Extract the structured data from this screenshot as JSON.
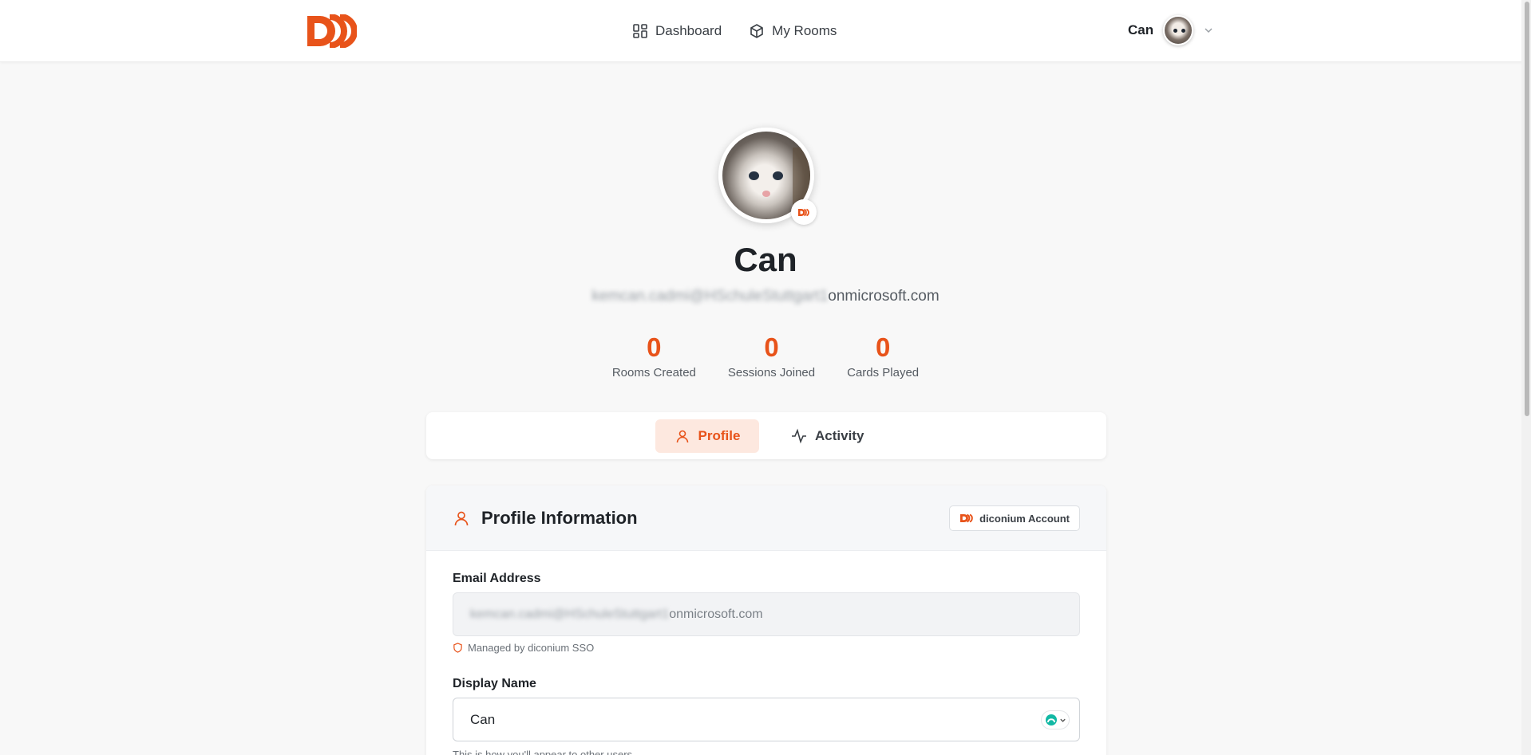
{
  "nav": {
    "links": [
      {
        "label": "Dashboard",
        "icon": "dashboard-icon"
      },
      {
        "label": "My Rooms",
        "icon": "cube-icon"
      }
    ],
    "user_name": "Can"
  },
  "profile": {
    "name": "Can",
    "email_hidden": "kemcan.cadmi@HSchuleStuttgart1",
    "email_visible": "onmicrosoft.com",
    "stats": [
      {
        "value": "0",
        "label": "Rooms Created"
      },
      {
        "value": "0",
        "label": "Sessions Joined"
      },
      {
        "value": "0",
        "label": "Cards Played"
      }
    ]
  },
  "tabs": {
    "profile": "Profile",
    "activity": "Activity"
  },
  "info": {
    "title": "Profile Information",
    "account_chip": "diconium Account",
    "email_label": "Email Address",
    "email_hidden": "kemcan.cadmi@HSchuleStuttgart1",
    "email_visible": "onmicrosoft.com",
    "sso_note": "Managed by diconium SSO",
    "display_name_label": "Display Name",
    "display_name_value": "Can",
    "display_name_hint": "This is how you'll appear to other users"
  },
  "colors": {
    "accent": "#e8531a",
    "accent_soft": "#fde8df"
  }
}
